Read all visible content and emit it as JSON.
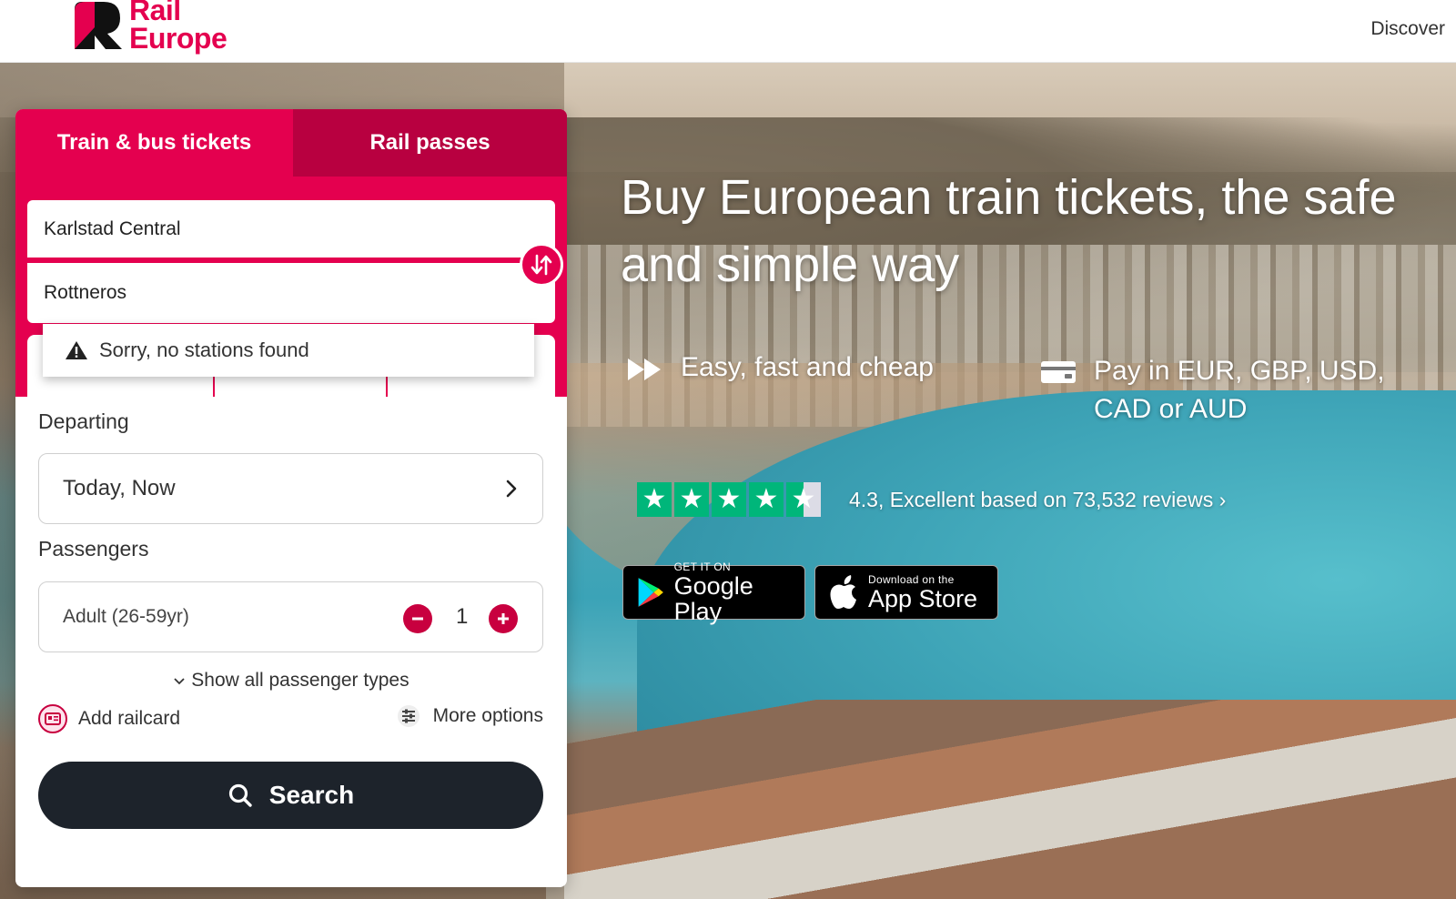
{
  "header": {
    "logo_line1": "Rail",
    "logo_line2": "Europe",
    "nav_discover": "Discover"
  },
  "booking": {
    "tabs": [
      "Train & bus tickets",
      "Rail passes"
    ],
    "from_value": "Karlstad Central",
    "to_value": "Rottneros",
    "dropdown_message": "Sorry, no stations found",
    "departing_label": "Departing",
    "departing_value": "Today, Now",
    "passengers_label": "Passengers",
    "passenger_type": "Adult (26-59yr)",
    "passenger_count": "1",
    "show_all": "Show all passenger types",
    "add_railcard": "Add railcard",
    "more_options": "More options",
    "search_label": "Search"
  },
  "hero": {
    "title": "Buy European train tickets, the safe and simple way",
    "feature1": "Easy, fast and cheap",
    "feature2": "Pay in EUR, GBP, USD, CAD or AUD",
    "rating_score": 4.3,
    "rating_text": "4.3, Excellent based on 73,532 reviews ›",
    "google_small": "GET IT ON",
    "google_big": "Google Play",
    "apple_small": "Download on the",
    "apple_big": "App Store"
  },
  "colors": {
    "brand": "#e4004f",
    "brand_dark": "#b80040",
    "search_button": "#1d232b",
    "trustpilot_green": "#00b67a"
  },
  "icons": [
    "swap-icon",
    "warning-icon",
    "chevron-right-icon",
    "minus-icon",
    "plus-icon",
    "chevron-down-icon",
    "railcard-icon",
    "sliders-icon",
    "search-icon",
    "fast-forward-icon",
    "payment-card-icon",
    "star-icon",
    "google-play-icon",
    "apple-icon"
  ]
}
